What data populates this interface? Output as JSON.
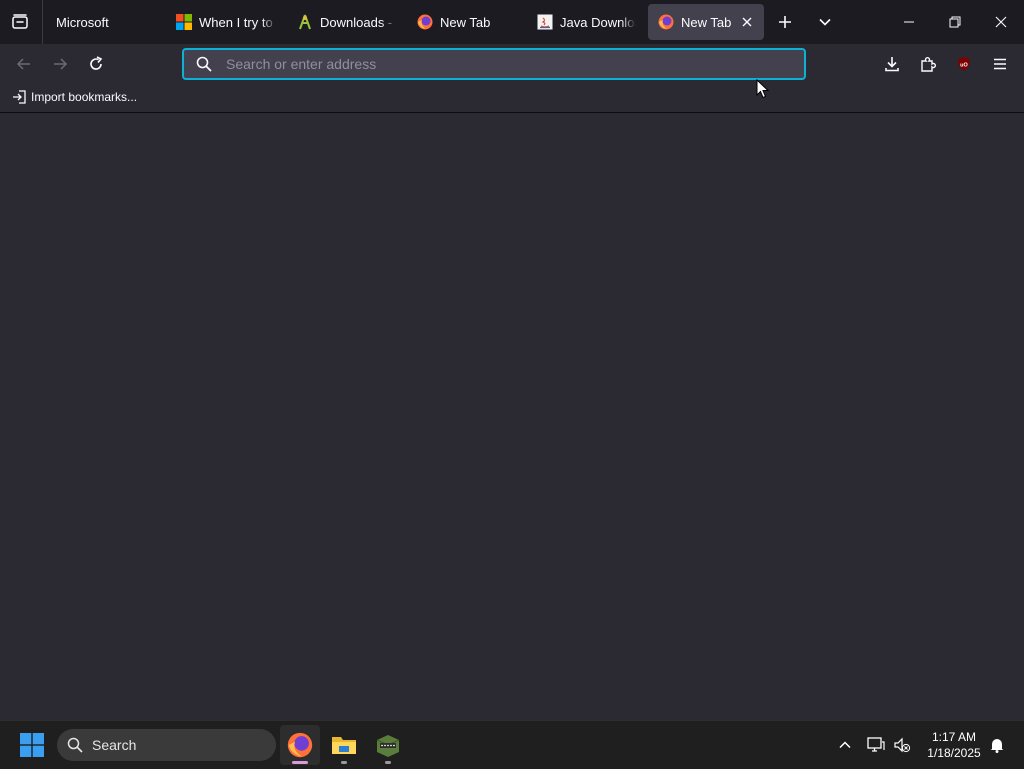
{
  "tabstrip": {
    "firefox_view_label": "Microsoft",
    "tabs": [
      {
        "title": "When I try to",
        "favicon": "microsoft-logo-icon",
        "selected": false
      },
      {
        "title": "Downloads - F",
        "favicon": "downloads-site-icon",
        "selected": false
      },
      {
        "title": "New Tab",
        "favicon": "firefox-icon",
        "selected": false
      },
      {
        "title": "Java Downloa",
        "favicon": "java-icon",
        "selected": false
      },
      {
        "title": "New Tab",
        "favicon": "firefox-icon",
        "selected": true
      }
    ],
    "new_tab_icon": "plus-icon",
    "list_tabs_icon": "chevron-down-icon"
  },
  "navbar": {
    "urlbar_placeholder": "Search or enter address",
    "urlbar_value": "",
    "urlbar_focus_color": "#0db0d6",
    "extension_badge": "uO"
  },
  "bookmarks": {
    "import_label": "Import bookmarks..."
  },
  "taskbar": {
    "search_label": "Search",
    "apps": [
      "firefox",
      "file-explorer",
      "minecraft-launcher"
    ],
    "time": "1:17 AM",
    "date": "1/18/2025"
  },
  "colors": {
    "toolbar": "#2b2a33",
    "tabstrip": "#1c1b22",
    "selected_tab": "#42414d",
    "taskbar": "#1f1f1f",
    "ublock_red": "#800000"
  }
}
